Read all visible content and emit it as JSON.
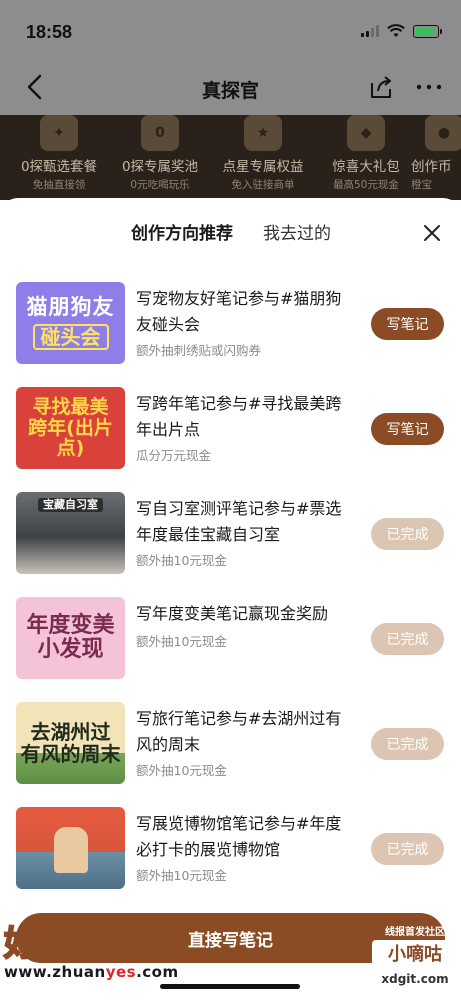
{
  "status_bar": {
    "time": "18:58"
  },
  "nav": {
    "title": "真探官"
  },
  "benefits": [
    {
      "title": "0探甄选套餐",
      "subtitle": "免抽直接领",
      "icon": "star-diamond-icon"
    },
    {
      "title": "0探专属奖池",
      "subtitle": "0元吃喝玩乐",
      "icon": "zero-yuan-icon"
    },
    {
      "title": "点星专属权益",
      "subtitle": "免入驻接商单",
      "icon": "star-icon"
    },
    {
      "title": "惊喜大礼包",
      "subtitle": "最高50元现金",
      "icon": "red-packet-icon"
    },
    {
      "title": "创作币",
      "subtitle": "橙宝",
      "icon": "coin-icon"
    }
  ],
  "sheet": {
    "tabs": [
      {
        "label": "创作方向推荐",
        "active": true
      },
      {
        "label": "我去过的",
        "active": false
      }
    ],
    "items": [
      {
        "title": "写宠物友好笔记参与#猫朋狗友碰头会",
        "subtitle": "额外抽刺绣贴或闪购券",
        "action": "写笔记",
        "status": "write",
        "thumb": {
          "line1": "猫朋狗友",
          "line2": "碰头会"
        }
      },
      {
        "title": "写跨年笔记参与#寻找最美跨年出片点",
        "subtitle": "瓜分万元现金",
        "action": "写笔记",
        "status": "write",
        "thumb": {
          "line1": "寻找最美",
          "line2": "跨年(出片点)"
        }
      },
      {
        "title": "写自习室测评笔记参与#票选年度最佳宝藏自习室",
        "subtitle": "额外抽10元现金",
        "action": "已完成",
        "status": "done",
        "thumb": {
          "line1": "宝藏自习室"
        }
      },
      {
        "title": "写年度变美笔记赢现金奖励",
        "subtitle": "额外抽10元现金",
        "action": "已完成",
        "status": "done",
        "thumb": {
          "line1": "年度变美",
          "line2": "小发现"
        }
      },
      {
        "title": "写旅行笔记参与#去湖州过有风的周末",
        "subtitle": "额外抽10元现金",
        "action": "已完成",
        "status": "done",
        "thumb": {
          "line1": "去湖州过",
          "line2": "有风的周末"
        }
      },
      {
        "title": "写展览博物馆笔记参与#年度必打卡的展览博物馆",
        "subtitle": "额外抽10元现金",
        "action": "已完成",
        "status": "done",
        "thumb": {
          "line1": ""
        }
      }
    ],
    "cta": "直接写笔记"
  },
  "watermark": {
    "left_brand": "好赚网",
    "left_url_a": "www.zhuan",
    "left_url_b": "yes",
    "left_url_c": ".com",
    "right_caption": "线报首发社区",
    "right_brand": "小嘀咕",
    "right_url": "xdgit.com"
  },
  "colors": {
    "accent_brown": "#8a4b25",
    "done_tan": "#dcc6b3",
    "dim_overlay": "#8d8d8d",
    "benefit_band": "#2a221a"
  }
}
